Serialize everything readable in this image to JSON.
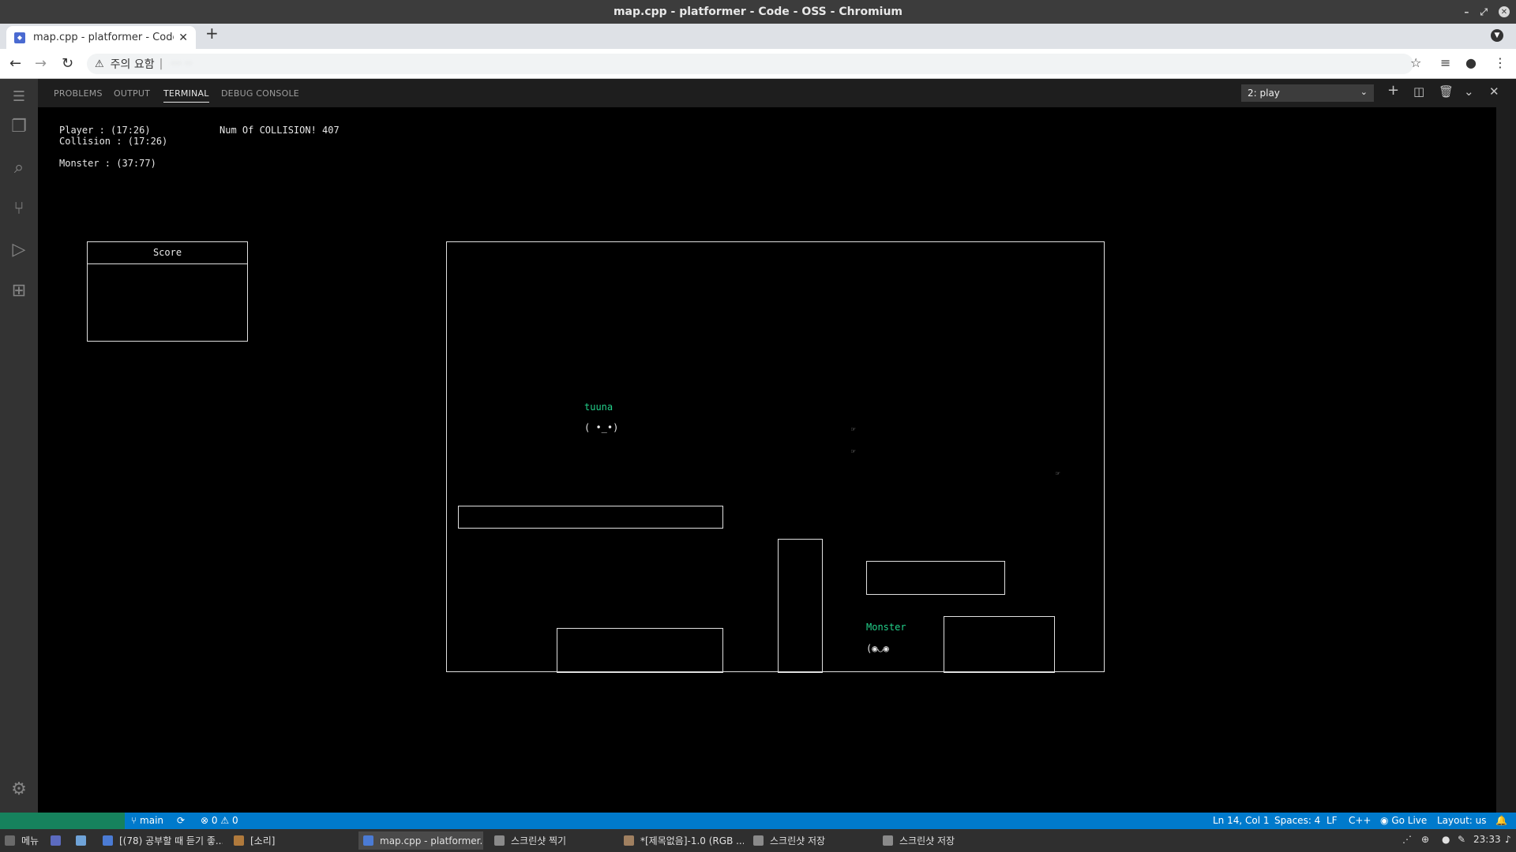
{
  "window": {
    "title": "map.cpp - platformer - Code - OSS - Chromium"
  },
  "browser": {
    "tab_title": "map.cpp - platformer - Code - OSS",
    "security_label": "주의 요함",
    "url": "··· ··"
  },
  "panel": {
    "tabs": [
      "PROBLEMS",
      "OUTPUT",
      "TERMINAL",
      "DEBUG CONSOLE"
    ],
    "active_tab": "TERMINAL",
    "terminal_selector": "2: play"
  },
  "terminal": {
    "player_line": "Player : (17:26)",
    "collision_line": "Collision : (17:26)",
    "collision_count_line": "Num Of COLLISION! 407",
    "monster_line": "Monster : (37:77)",
    "score_label": "Score",
    "player_name": "tuuna",
    "player_face": "( •_•)",
    "monster_name": "Monster",
    "monster_face": "(◉◡◉",
    "projectile_glyph": "☞"
  },
  "statusbar": {
    "branch": "main",
    "errors": "0",
    "warnings": "0",
    "cursor": "Ln 14, Col 1",
    "spaces": "Spaces: 4",
    "eol": "LF",
    "language": "C++",
    "golive": "Go Live",
    "layout": "Layout: us"
  },
  "taskbar": {
    "menu_label": "메뉴",
    "tasks": [
      "[(78) 공부할 때 듣기 좋...",
      "[소리]",
      "map.cpp - platformer...",
      "스크린샷 찍기",
      "*[제목없음]-1.0 (RGB ...",
      "스크린샷 저장",
      "스크린샷 저장"
    ],
    "clock": "23:33"
  }
}
